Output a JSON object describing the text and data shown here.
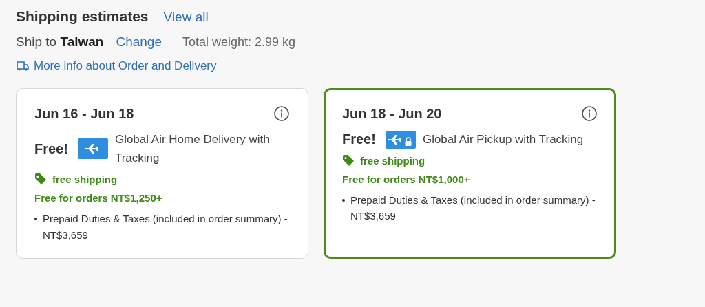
{
  "header": {
    "title": "Shipping estimates",
    "link": "View all"
  },
  "destination": {
    "text": "Ship to **Taiwan**",
    "link": "Change",
    "weight": "Total weight: 2.99 kg"
  },
  "info_link": "More info about Order and Delivery",
  "options": [
    {
      "dates": "Jun 16 - Jun 18",
      "price": "Free!",
      "kind": "home",
      "service": "Global Air Home Delivery with Tracking",
      "tag": "free shipping",
      "threshold": "Free for orders NT$1,250+",
      "notes": [
        "Prepaid Duties & Taxes (included in order summary) - NT$3,659"
      ],
      "selected": false
    },
    {
      "dates": "Jun 18 - Jun 20",
      "price": "Free!",
      "kind": "pickup",
      "service": "Global Air Pickup with Tracking",
      "tag": "free shipping",
      "threshold": "Free for orders NT$1,000+",
      "notes": [
        "Prepaid Duties & Taxes (included in order summary) - NT$3,659"
      ],
      "selected": true
    }
  ]
}
